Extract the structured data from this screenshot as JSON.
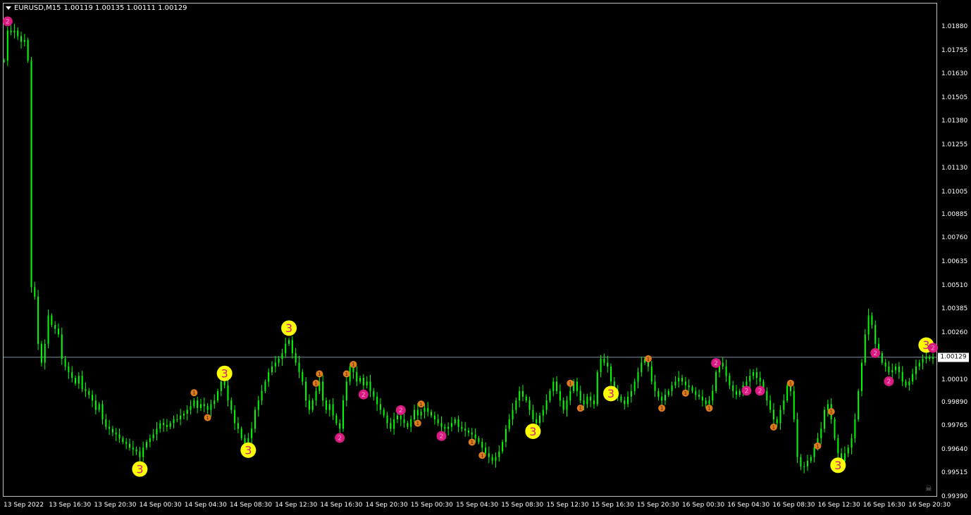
{
  "symbol": {
    "name": "EURUSD,M15",
    "ohlc": "1.00119 1.00135 1.00111 1.00129"
  },
  "price_axis": [
    "1.01880",
    "1.01755",
    "1.01630",
    "1.01505",
    "1.01380",
    "1.01255",
    "1.01130",
    "1.01005",
    "1.00885",
    "1.00760",
    "1.00635",
    "1.00510",
    "1.00385",
    "1.00260",
    "1.00129",
    "1.00010",
    "0.99890",
    "0.99765",
    "0.99640",
    "0.99515",
    "0.99390"
  ],
  "current_price": "1.00129",
  "time_axis": [
    "13 Sep 2022",
    "13 Sep 16:30",
    "13 Sep 20:30",
    "14 Sep 00:30",
    "14 Sep 04:30",
    "14 Sep 08:30",
    "14 Sep 12:30",
    "14 Sep 16:30",
    "14 Sep 20:30",
    "15 Sep 00:30",
    "15 Sep 04:30",
    "15 Sep 08:30",
    "15 Sep 12:30",
    "15 Sep 16:30",
    "15 Sep 20:30",
    "16 Sep 00:30",
    "16 Sep 04:30",
    "16 Sep 08:30",
    "16 Sep 12:30",
    "16 Sep 16:30",
    "16 Sep 20:30"
  ],
  "colors": {
    "background": "#000000",
    "candle": "#00ff00",
    "grid_border": "#c0c0c0",
    "current_price_line": "#7f8fa6",
    "marker_level1": "#e07b1c",
    "marker_level2": "#d81b80",
    "marker_level3": "#ffff00"
  },
  "markers": [
    {
      "level": "2",
      "i": 1
    },
    {
      "level": "3",
      "i": 40
    },
    {
      "level": "1",
      "i": 56
    },
    {
      "level": "1",
      "i": 60
    },
    {
      "level": "3",
      "i": 65
    },
    {
      "level": "3",
      "i": 72
    },
    {
      "level": "3",
      "i": 84
    },
    {
      "level": "1",
      "i": 93
    },
    {
      "level": "1",
      "i": 92
    },
    {
      "level": "1",
      "i": 101
    },
    {
      "level": "1",
      "i": 103
    },
    {
      "level": "2",
      "i": 99
    },
    {
      "level": "2",
      "i": 106
    },
    {
      "level": "2",
      "i": 117
    },
    {
      "level": "1",
      "i": 122
    },
    {
      "level": "1",
      "i": 123
    },
    {
      "level": "2",
      "i": 129
    },
    {
      "level": "1",
      "i": 138
    },
    {
      "level": "1",
      "i": 141
    },
    {
      "level": "3",
      "i": 156
    },
    {
      "level": "1",
      "i": 167
    },
    {
      "level": "1",
      "i": 170
    },
    {
      "level": "3",
      "i": 179
    },
    {
      "level": "1",
      "i": 190
    },
    {
      "level": "1",
      "i": 194
    },
    {
      "level": "1",
      "i": 201
    },
    {
      "level": "1",
      "i": 208
    },
    {
      "level": "2",
      "i": 210
    },
    {
      "level": "2",
      "i": 219
    },
    {
      "level": "2",
      "i": 223
    },
    {
      "level": "1",
      "i": 227
    },
    {
      "level": "1",
      "i": 232
    },
    {
      "level": "1",
      "i": 240
    },
    {
      "level": "1",
      "i": 244
    },
    {
      "level": "3",
      "i": 246
    },
    {
      "level": "2",
      "i": 257
    },
    {
      "level": "2",
      "i": 261
    },
    {
      "level": "3",
      "i": 272
    },
    {
      "level": "2",
      "i": 282
    },
    {
      "level": "2",
      "i": 290
    }
  ],
  "markers_note": "",
  "chart_data": {
    "type": "line",
    "title": "",
    "series": [
      {
        "values": [
          1.017,
          1.0186,
          1.0185,
          1.0186,
          1.0183,
          1.018,
          1.0181,
          1.017,
          1.005,
          1.0045,
          1.002,
          1.001,
          1.002,
          1.0035,
          1.003,
          1.0028,
          1.0025,
          1.0012,
          1.0008,
          1.0005,
          1.0002,
          0.9999,
          1.0003,
          0.9996,
          0.9995,
          0.9993,
          0.999,
          0.9985,
          0.9988,
          0.998,
          0.9976,
          0.9975,
          0.9973,
          0.9972,
          0.997,
          0.9968,
          0.9967,
          0.9965,
          0.9964,
          0.9963,
          0.996,
          0.9965,
          0.9968,
          0.997,
          0.9972,
          0.9975,
          0.9978,
          0.9977,
          0.9976,
          0.9978,
          0.998,
          0.998,
          0.9982,
          0.9983,
          0.9985,
          0.9987,
          0.999,
          0.9986,
          0.9988,
          0.9987,
          0.9985,
          0.9988,
          0.999,
          0.9995,
          1.0,
          0.9998,
          0.999,
          0.9985,
          0.9978,
          0.9975,
          0.997,
          0.9965,
          0.997,
          0.9975,
          0.9985,
          0.999,
          0.9995,
          1.0,
          1.0005,
          1.0008,
          1.001,
          1.0012,
          1.0015,
          1.002,
          1.0022,
          1.0015,
          1.001,
          1.0005,
          1.0,
          0.999,
          0.9985,
          0.999,
          0.9995,
          1.0,
          0.999,
          0.9985,
          0.9988,
          0.9982,
          0.9978,
          0.9975,
          0.999,
          1.0,
          1.0008,
          1.0005,
          1.0,
          1.0002,
          0.9998,
          1.0,
          0.9995,
          0.9992,
          0.9988,
          0.9985,
          0.9982,
          0.9978,
          0.9975,
          0.998,
          0.9982,
          0.998,
          0.9978,
          0.9976,
          0.998,
          0.9985,
          0.9982,
          0.9984,
          0.9986,
          0.9984,
          0.9982,
          0.998,
          0.9978,
          0.9976,
          0.9975,
          0.9976,
          0.9978,
          0.998,
          0.9976,
          0.9975,
          0.9974,
          0.9973,
          0.9972,
          0.997,
          0.9968,
          0.9965,
          0.9962,
          0.996,
          0.9958,
          0.996,
          0.9963,
          0.9968,
          0.9975,
          0.998,
          0.9985,
          0.999,
          0.9995,
          0.9992,
          0.999,
          0.9985,
          0.998,
          0.9978,
          0.9982,
          0.9985,
          0.999,
          0.9995,
          1.0,
          0.9995,
          0.999,
          0.9985,
          0.999,
          0.9995,
          1.0,
          0.9995,
          0.999,
          0.9988,
          0.9992,
          0.999,
          0.9988,
          1.0005,
          1.0012,
          1.001,
          1.0008,
          1.0,
          0.9995,
          0.9992,
          0.999,
          0.9988,
          0.9992,
          0.9995,
          1.0,
          1.0005,
          1.001,
          1.0012,
          1.0008,
          1.0,
          0.9995,
          0.9992,
          0.999,
          0.9993,
          0.9995,
          0.9998,
          1.0,
          1.0002,
          1.0,
          0.9998,
          0.9997,
          0.9995,
          0.9993,
          0.9992,
          0.999,
          0.9988,
          0.999,
          0.9995,
          1.0005,
          1.001,
          1.0008,
          1.0003,
          0.9998,
          0.9995,
          0.9993,
          0.9995,
          0.9998,
          1.0,
          1.0003,
          1.0005,
          1.0002,
          1.0,
          0.9995,
          0.999,
          0.9985,
          0.998,
          0.9978,
          0.9985,
          0.999,
          0.9998,
          0.9995,
          0.998,
          0.996,
          0.9955,
          0.9955,
          0.9958,
          0.996,
          0.9965,
          0.997,
          0.9975,
          0.9985,
          0.9988,
          0.998,
          0.997,
          0.9962,
          0.9958,
          0.9962,
          0.9965,
          0.997,
          0.998,
          0.9995,
          1.001,
          1.0025,
          1.0035,
          1.003,
          1.002,
          1.0015,
          1.001,
          1.0008,
          1.0005,
          1.0006,
          1.0008,
          1.0005,
          1.0,
          0.9998,
          1.0,
          1.0004,
          1.0008,
          1.001,
          1.0012,
          1.0013,
          1.0012,
          1.0013
        ]
      }
    ],
    "ylim": [
      0.9939,
      1.0188
    ],
    "xlabel": "",
    "ylabel": ""
  }
}
